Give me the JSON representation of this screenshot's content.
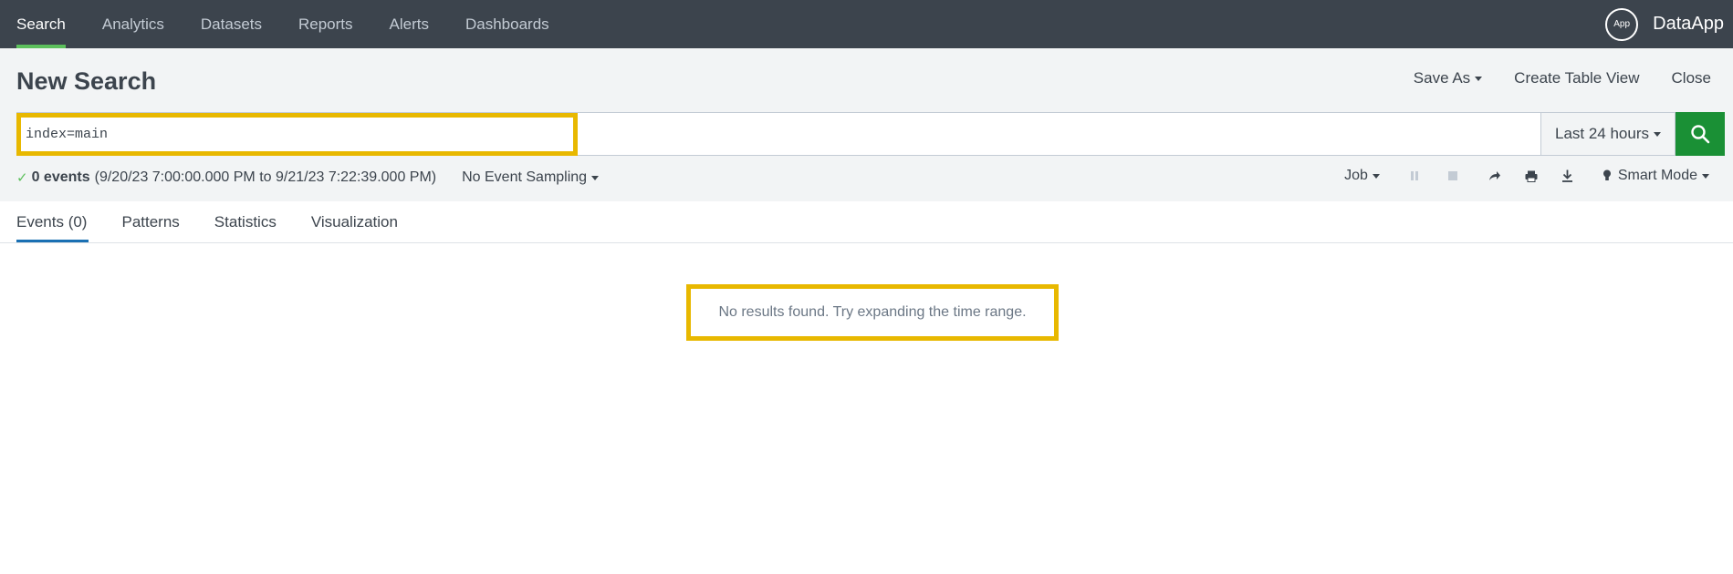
{
  "nav": {
    "items": [
      {
        "label": "Search",
        "active": true
      },
      {
        "label": "Analytics",
        "active": false
      },
      {
        "label": "Datasets",
        "active": false
      },
      {
        "label": "Reports",
        "active": false
      },
      {
        "label": "Alerts",
        "active": false
      },
      {
        "label": "Dashboards",
        "active": false
      }
    ],
    "app_badge": "App",
    "app_name": "DataApp"
  },
  "header": {
    "title": "New Search",
    "save_as": "Save As",
    "create_table_view": "Create Table View",
    "close": "Close"
  },
  "search": {
    "query": "index=main",
    "time_range": "Last 24 hours",
    "button_icon": "search-icon"
  },
  "status": {
    "check_icon": "✓",
    "count": "0 events",
    "range": "(9/20/23 7:00:00.000 PM to 9/21/23 7:22:39.000 PM)",
    "sampling": "No Event Sampling"
  },
  "job": {
    "label": "Job",
    "mode": "Smart Mode",
    "icons": [
      "pause-icon",
      "stop-icon",
      "share-icon",
      "print-icon",
      "download-icon",
      "lightbulb-icon"
    ]
  },
  "tabs": [
    {
      "label": "Events (0)",
      "active": true
    },
    {
      "label": "Patterns",
      "active": false
    },
    {
      "label": "Statistics",
      "active": false
    },
    {
      "label": "Visualization",
      "active": false
    }
  ],
  "results": {
    "empty_message": "No results found. Try expanding the time range."
  },
  "colors": {
    "nav_bg": "#3c444d",
    "accent_green": "#5cc05c",
    "search_button": "#1a9035",
    "tab_active": "#1a70b3",
    "highlight": "#e8b800"
  }
}
